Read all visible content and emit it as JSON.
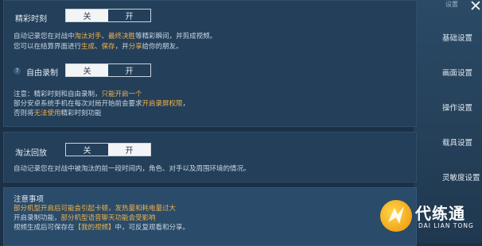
{
  "panel1": {
    "highlight": {
      "title": "精彩时刻",
      "toggle": {
        "off": "关",
        "on": "开",
        "selected": "off"
      },
      "desc1_a": "自动记录您在对战中",
      "desc1_b": "淘汰对手",
      "desc1_c": "、",
      "desc1_d": "最终决胜",
      "desc1_e": "等精彩瞬间，并剪成视频。",
      "desc2_a": "您可以在结算界面进行",
      "desc2_b": "生成",
      "desc2_c": "、",
      "desc2_d": "保存",
      "desc2_e": "，并",
      "desc2_f": "分享",
      "desc2_g": "给你的朋友。"
    },
    "free_record": {
      "help": "?",
      "title": "自由录制",
      "toggle": {
        "off": "关",
        "on": "开",
        "selected": "off"
      },
      "note1_a": "注意：精彩时刻和自由录制，",
      "note1_b": "只能开启一个",
      "note2_a": "部分安卓系统手机在每次对局开始前会要求",
      "note2_b": "开启录屏权限",
      "note2_c": "，",
      "note3_a": "否则将",
      "note3_b": "无法使用",
      "note3_c": "精彩时刻功能"
    }
  },
  "panel2": {
    "title": "淘汰回放",
    "toggle": {
      "off": "关",
      "on": "开",
      "selected": "on"
    },
    "desc": "自动记录您在对战中被淘汰的前一段时间内，角色、对手以及周围环境的情况。"
  },
  "panel3": {
    "title": "注意事项",
    "line1": "部分机型开启后可能会引起卡顿，发热量和耗电量过大",
    "line2_a": "开启录制功能，",
    "line2_b": "部分机型语音聊天功能会受影响",
    "line3_a": "视频生成后可保存在",
    "line3_b": "【我的视频】",
    "line3_c": "中，可反复观看和分享。"
  },
  "sidebar": {
    "top": "设置",
    "items": [
      "基础设置",
      "画面设置",
      "操作设置",
      "载具设置",
      "灵敏度设置"
    ]
  },
  "watermark": {
    "cn": "代练通",
    "en": "DAI LIAN TONG"
  }
}
